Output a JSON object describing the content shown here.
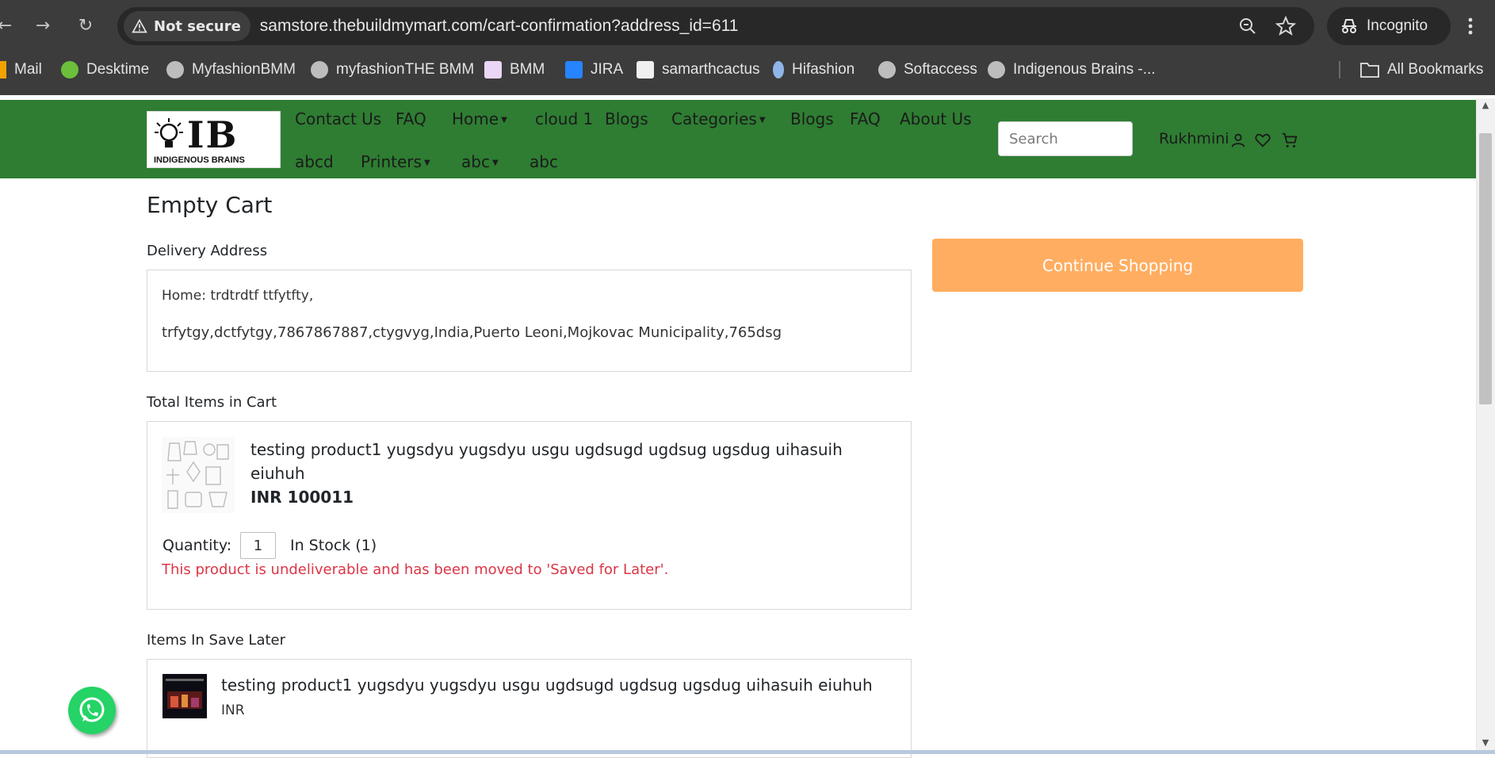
{
  "browser": {
    "security_label": "Not secure",
    "url": "samstore.thebuildmymart.com/cart-confirmation?address_id=611",
    "profile_label": "Incognito",
    "bookmarks": [
      "Mail",
      "Desktime",
      "MyfashionBMM",
      "myfashionTHE BMM",
      "BMM",
      "JIRA",
      "samarthcactus",
      "Hifashion",
      "Softaccess",
      "Indigenous Brains -..."
    ],
    "all_bookmarks_label": "All Bookmarks"
  },
  "header": {
    "logo_text": "IB",
    "logo_subtext": "INDIGENOUS BRAINS",
    "nav_row1": [
      "Contact Us",
      "FAQ",
      "Home",
      "cloud 1",
      "Blogs",
      "Categories",
      "Blogs",
      "FAQ",
      "About Us"
    ],
    "nav_row2": [
      "abcd",
      "Printers",
      "abc",
      "abc"
    ],
    "search_placeholder": "Search",
    "user_name": "Rukhmini"
  },
  "main": {
    "title": "Empty Cart",
    "delivery_label": "Delivery Address",
    "address_line1": "Home: trdtrdtf ttfytfty,",
    "address_line2": "trfytgy,dctfytgy,7867867887,ctygvyg,India,Puerto Leoni,Mojkovac Municipality,765dsg",
    "continue_label": "Continue Shopping",
    "cart_label": "Total Items in Cart",
    "cart_item": {
      "title": "testing product1 yugsdyu yugsdyu usgu ugdsugd ugdsug ugsdug uihasuih eiuhuh",
      "price": "INR 100011",
      "quantity_label": "Quantity:",
      "quantity": "1",
      "stock": "In Stock (1)",
      "message": "This product is undeliverable and has been moved to 'Saved for Later'."
    },
    "saved_label": "Items In Save Later",
    "saved_item": {
      "title": "testing product1 yugsdyu yugsdyu usgu ugdsugd ugdsug ugsdug uihasuih eiuhuh",
      "price": "INR"
    }
  },
  "colors": {
    "header_green": "#2e7d32",
    "continue_orange": "#ffad60",
    "error_red": "#dc3545",
    "whatsapp_green": "#25d366"
  }
}
